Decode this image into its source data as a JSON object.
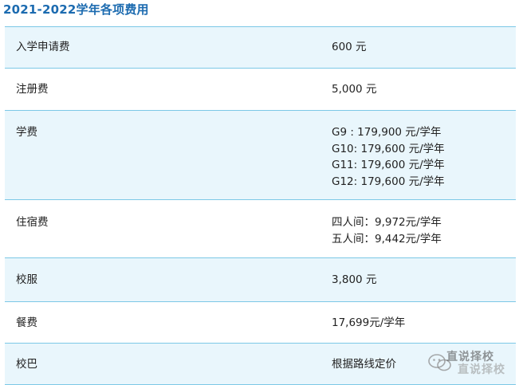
{
  "title": "2021-2022学年各项费用",
  "fees": [
    {
      "name": "入学申请费",
      "values": [
        "600 元"
      ]
    },
    {
      "name": "注册费",
      "values": [
        "5,000 元"
      ]
    },
    {
      "name": "学费",
      "values": [
        "G9 : 179,900 元/学年",
        "G10: 179,600 元/学年",
        "G11: 179,600 元/学年",
        "G12: 179,600 元/学年"
      ]
    },
    {
      "name": "住宿费",
      "values": [
        "四人间：9,972元/学年",
        "五人间：9,442元/学年"
      ]
    },
    {
      "name": "校服",
      "values": [
        "3,800 元"
      ]
    },
    {
      "name": "餐费",
      "values": [
        "17,699元/学年"
      ]
    },
    {
      "name": "校巴",
      "values": [
        "根据路线定价"
      ]
    }
  ],
  "watermark": {
    "line1": "直说择校",
    "line2": "直说择校"
  },
  "colors": {
    "title": "#1c6bb0",
    "row_shade": "#e9f6fc",
    "border": "#7cc8e6"
  }
}
